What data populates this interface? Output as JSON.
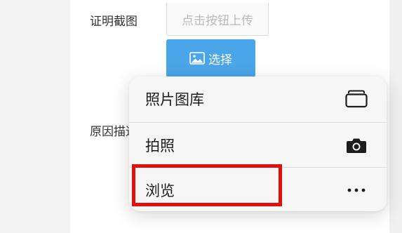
{
  "form": {
    "proof_label": "证明截图",
    "upload_placeholder": "点击按钮上传",
    "select_button_label": "选择",
    "reason_label": "原因描述"
  },
  "action_sheet": {
    "items": [
      {
        "label": "照片图库",
        "icon": "photo-library-icon"
      },
      {
        "label": "拍照",
        "icon": "camera-icon"
      },
      {
        "label": "浏览",
        "icon": "more-dots-icon"
      }
    ]
  },
  "colors": {
    "select_button": "#4aa6e8",
    "highlight": "#e40e0e",
    "sheet_background": "#f6f6f7"
  }
}
